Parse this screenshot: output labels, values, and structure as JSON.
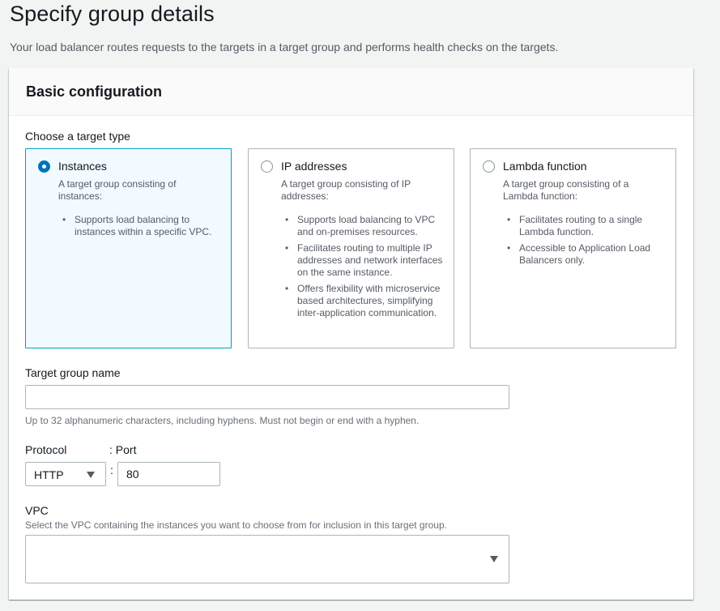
{
  "page": {
    "title": "Specify group details",
    "description": "Your load balancer routes requests to the targets in a target group and performs health checks on the targets."
  },
  "basic_config": {
    "title": "Basic configuration",
    "target_type_label": "Choose a target type",
    "target_types": [
      {
        "title": "Instances",
        "selected": true,
        "description": "A target group consisting of instances:",
        "bullets": [
          "Supports load balancing to instances within a specific VPC."
        ]
      },
      {
        "title": "IP addresses",
        "selected": false,
        "description": "A target group consisting of IP addresses:",
        "bullets": [
          "Supports load balancing to VPC and on-premises resources.",
          "Facilitates routing to multiple IP addresses and network interfaces on the same instance.",
          "Offers flexibility with microservice based architectures, simplifying inter-application communication."
        ]
      },
      {
        "title": "Lambda function",
        "selected": false,
        "description": "A target group consisting of a Lambda function:",
        "bullets": [
          "Facilitates routing to a single Lambda function.",
          "Accessible to Application Load Balancers only."
        ]
      }
    ],
    "target_group_name": {
      "label": "Target group name",
      "value": "",
      "hint": "Up to 32 alphanumeric characters, including hyphens. Must not begin or end with a hyphen."
    },
    "protocol": {
      "label": "Protocol",
      "value": "HTTP"
    },
    "port": {
      "label": ": Port",
      "separator": ":",
      "value": "80"
    },
    "vpc": {
      "label": "VPC",
      "hint": "Select the VPC containing the instances you want to choose from for inclusion in this target group.",
      "value": ""
    }
  },
  "colors": {
    "accent": "#0073bb",
    "selected_border": "#00a1c9",
    "selected_bg": "#f1faff",
    "border": "#aab7b8",
    "background": "#f2f3f3"
  },
  "icons": {
    "caret": "caret-down-icon",
    "radio": "radio-icon"
  }
}
